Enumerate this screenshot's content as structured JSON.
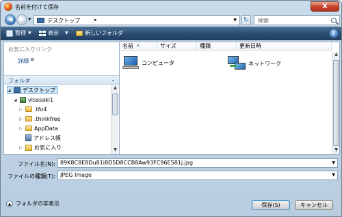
{
  "window": {
    "title": "名前を付けて保存",
    "close_label": "X"
  },
  "address": {
    "location": "デスクトップ",
    "search_placeholder": "検索"
  },
  "toolbar": {
    "organize_label": "整理",
    "view_label": "表示",
    "new_folder_label": "新しいフォルダ",
    "help": "?"
  },
  "favorites": {
    "title": "お気に入りリンク",
    "details_label": "詳細",
    "more": "»"
  },
  "folders": {
    "bar_label": "フォルダ",
    "tree": [
      {
        "label": "デスクトップ",
        "expanded": true,
        "selected": true,
        "icon": "desktop-icon"
      },
      {
        "label": "vlsasaki1",
        "expanded": true,
        "icon": "user-folder-icon"
      },
      {
        "label": ".tfo4",
        "expanded": false,
        "icon": "folder-icon"
      },
      {
        "label": ".thinkfree",
        "expanded": false,
        "icon": "folder-icon"
      },
      {
        "label": "AppData",
        "expanded": false,
        "icon": "folder-icon"
      },
      {
        "label": "アドレス帳",
        "expanded": false,
        "icon": "address-book-icon"
      },
      {
        "label": "お気に入り",
        "expanded": false,
        "icon": "favorites-folder-icon"
      }
    ]
  },
  "file_list": {
    "columns": [
      "名前",
      "サイズ",
      "種類",
      "更新日時"
    ],
    "items": [
      {
        "name": "コンピュータ",
        "icon": "computer-icon"
      },
      {
        "name": "ネットワーク",
        "icon": "network-icon"
      }
    ]
  },
  "form": {
    "filename_label": "ファイル名(N):",
    "filename_value": "89K8C8E8Du81i8D5D8CCB8Aw93FC96E581j.jpg",
    "filetype_label": "ファイルの種類(T):",
    "filetype_value": "JPEG Image"
  },
  "footer": {
    "hide_folders_label": "フォルダの非表示",
    "save_label": "保存(S)",
    "cancel_label": "キャンセル"
  },
  "colors": {
    "toolbar": "#2d4f74",
    "accent": "#1a4f8a",
    "window_bg": "#c9dbea",
    "close": "#c9452d"
  }
}
